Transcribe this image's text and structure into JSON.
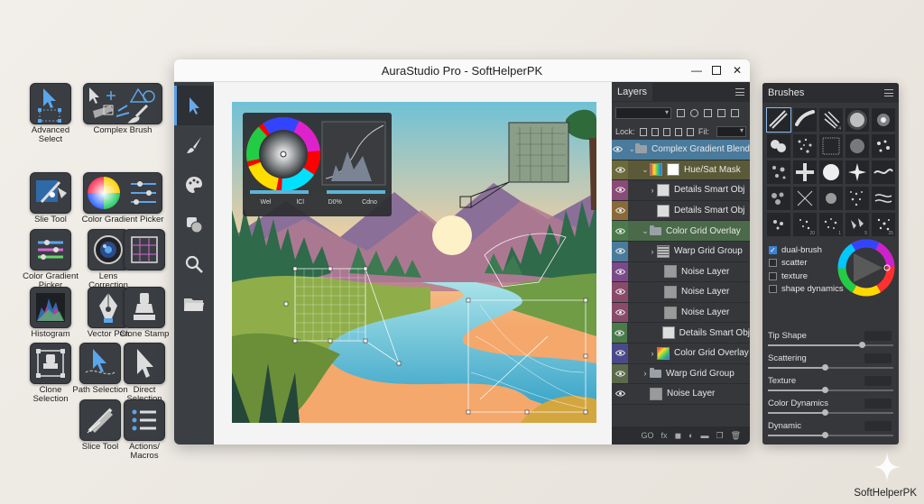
{
  "window": {
    "title": "AuraStudio Pro - SoftHelperPK",
    "minimize": "—",
    "maximize": "☐",
    "close": "✕"
  },
  "left_tools": [
    {
      "name": "advanced-select",
      "label": "Advanced Select"
    },
    {
      "name": "complex-brush",
      "label": "Complex Brush"
    },
    {
      "name": "slice-tool-a",
      "label": "Slie Tool"
    },
    {
      "name": "color-gradient-picker",
      "label": "Color Gradient Picker"
    },
    {
      "name": "color-gradient-picker-b",
      "label": "Color Gradient Picker"
    },
    {
      "name": "lens-correction",
      "label": "Lens Correction"
    },
    {
      "name": "histogram",
      "label": "Histogram"
    },
    {
      "name": "vector-pen",
      "label": "Vector Pen"
    },
    {
      "name": "clone-stamp",
      "label": "Clone Stamp"
    },
    {
      "name": "clone-selection",
      "label": "Clone Selection"
    },
    {
      "name": "path-selection",
      "label": "Path Selection"
    },
    {
      "name": "direct-selection",
      "label": "Direct Selection"
    },
    {
      "name": "slice-tool",
      "label": "Slice Tool"
    },
    {
      "name": "actions-macros",
      "label": "Actions/ Macros"
    }
  ],
  "sidebar": [
    "select-arrow",
    "brush",
    "palette",
    "shapes",
    "zoom",
    "folder"
  ],
  "color_widget": {
    "labels": [
      "Wel",
      "lCl",
      "D0%",
      "Cdno"
    ]
  },
  "layers_panel": {
    "title": "Layers",
    "lock_label": "Lock:",
    "fill_label": "Fil:",
    "layers": [
      {
        "name": "Complex Gradient Blend",
        "indent": 0,
        "kind": "folder",
        "expanded": true,
        "color": "#4a7a9c",
        "eye_color": "#4a7a9c",
        "selected": true
      },
      {
        "name": "Hue/Sat Mask",
        "indent": 1,
        "kind": "adjust",
        "expanded": true,
        "color": "#5a5a38",
        "eye_color": "#6b6a3a"
      },
      {
        "name": "Details Smart Obj",
        "indent": 2,
        "kind": "smart",
        "expanded": false,
        "color": "#35373b",
        "eye_color": "#8a4b78"
      },
      {
        "name": "Details Smart Obj",
        "indent": 2,
        "kind": "smart",
        "expanded": null,
        "color": "#35373b",
        "eye_color": "#8a6a38"
      },
      {
        "name": "Color Grid Overlay",
        "indent": 1,
        "kind": "folder",
        "expanded": true,
        "color": "#4a6a4a",
        "eye_color": "#4b7a4b"
      },
      {
        "name": "Warp Grid Group",
        "indent": 2,
        "kind": "grid",
        "expanded": false,
        "color": "#35373b",
        "eye_color": "#4a7a9c"
      },
      {
        "name": "Noise Layer",
        "indent": 3,
        "kind": "noise",
        "expanded": null,
        "color": "#35373b",
        "eye_color": "#7a4a8a"
      },
      {
        "name": "Noise Layer",
        "indent": 3,
        "kind": "noise",
        "expanded": null,
        "color": "#35373b",
        "eye_color": "#8a4a6a"
      },
      {
        "name": "Noise Layer",
        "indent": 3,
        "kind": "noise",
        "expanded": null,
        "color": "#35373b",
        "eye_color": "#8a4a6a"
      },
      {
        "name": "Details Smart Obj",
        "indent": 3,
        "kind": "smart",
        "expanded": null,
        "color": "#35373b",
        "eye_color": "#4b7a4b"
      },
      {
        "name": "Color Grid Overlay",
        "indent": 2,
        "kind": "color",
        "expanded": false,
        "color": "#35373b",
        "eye_color": "#4a4a8a"
      },
      {
        "name": "Warp Grid Group",
        "indent": 1,
        "kind": "folder",
        "expanded": false,
        "color": "#35373b",
        "eye_color": "#5a6a4a"
      },
      {
        "name": "Noise Layer",
        "indent": 1,
        "kind": "noise",
        "expanded": null,
        "color": "#35373b",
        "eye_color": "#35373b"
      }
    ],
    "footer": [
      "GO",
      "fx",
      "◼",
      "◐",
      "▬",
      "❐",
      "🗑"
    ]
  },
  "brushes_panel": {
    "title": "Brushes",
    "brush_numbers": [
      "",
      "",
      "4",
      "",
      "",
      "",
      "",
      "",
      "",
      "",
      "",
      "",
      "",
      "",
      "",
      "",
      "",
      "",
      "",
      "",
      "",
      "20",
      "1",
      "5",
      "25"
    ],
    "options": [
      {
        "label": "dual-brush",
        "checked": true
      },
      {
        "label": "scatter",
        "checked": false
      },
      {
        "label": "texture",
        "checked": false
      },
      {
        "label": "shape dynamics",
        "checked": false
      }
    ],
    "sliders": [
      {
        "label": "Tip Shape",
        "value": 0.75
      },
      {
        "label": "Scattering",
        "value": 0.45
      },
      {
        "label": "Texture",
        "value": 0.45
      },
      {
        "label": "Color Dynamics",
        "value": 0.45
      },
      {
        "label": "Dynamic",
        "value": 0.45
      }
    ]
  },
  "watermark": "SoftHelperPK"
}
